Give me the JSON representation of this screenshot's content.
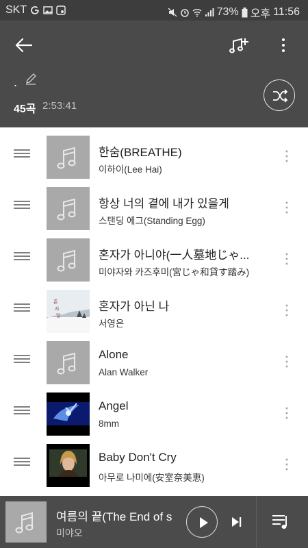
{
  "status": {
    "carrier": "SKT",
    "battery": "73%",
    "ampm": "오후",
    "time": "11:56"
  },
  "header": {
    "playlist_name": ".",
    "track_count": "45곡",
    "total_time": "2:53:41"
  },
  "songs": [
    {
      "title": "한숨(BREATHE)",
      "artist": "이하이(Lee Hai)",
      "art": "placeholder"
    },
    {
      "title": "항상 너의 곁에 내가 있을게",
      "artist": "스탠딩 에그(Standing Egg)",
      "art": "placeholder"
    },
    {
      "title": "혼자가 아니야(一人墓地じゃ...",
      "artist": "미야자와 카즈후미(宮じゃ和貸す踏み)",
      "art": "placeholder"
    },
    {
      "title": "혼자가 아닌 나",
      "artist": "서영은",
      "art": "album-winter"
    },
    {
      "title": "Alone",
      "artist": "Alan Walker",
      "art": "placeholder"
    },
    {
      "title": "Angel",
      "artist": "8mm",
      "art": "album-blue"
    },
    {
      "title": "Baby Don't Cry",
      "artist": "아무로 나미에(安室奈美恵)",
      "art": "album-portrait"
    }
  ],
  "album_text": "혼\n사\n닿",
  "player": {
    "title": "여름의 끝(The End of s",
    "artist": "미야오"
  },
  "colors": {
    "header_bg": "#4a4a4a",
    "status_bg": "#3d3d3d",
    "player_bg": "#4b4b4b",
    "placeholder_bg": "#a9a9a9"
  }
}
